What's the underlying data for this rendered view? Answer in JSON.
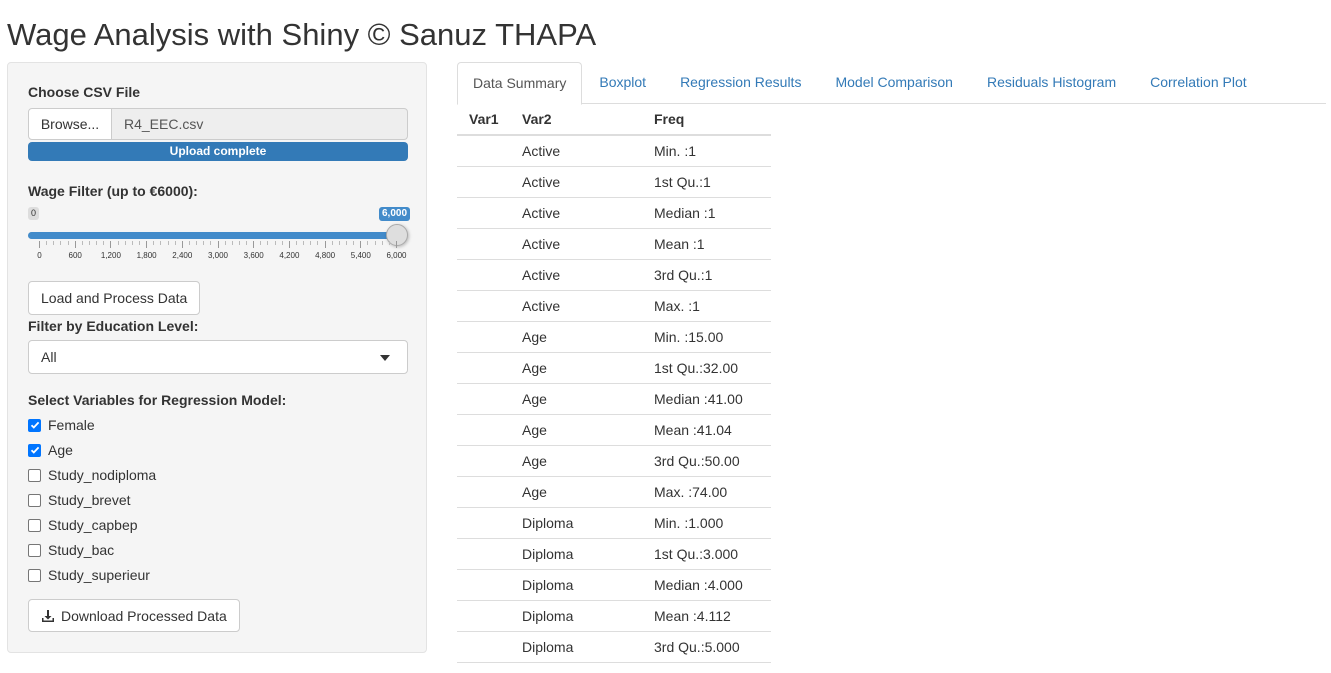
{
  "app": {
    "title": "Wage Analysis with Shiny © Sanuz THAPA"
  },
  "sidebar": {
    "file_label": "Choose CSV File",
    "browse_label": "Browse...",
    "file_name": "R4_EEC.csv",
    "upload_status": "Upload complete",
    "upload_progress": 1.0,
    "wage_label": "Wage Filter (up to €6000):",
    "slider": {
      "min_label": "0",
      "max_label": "6,000",
      "value": 6000,
      "min": 0,
      "max": 6000,
      "ticks": [
        "0",
        "600",
        "1,200",
        "1,800",
        "2,400",
        "3,000",
        "3,600",
        "4,200",
        "4,800",
        "5,400",
        "6,000"
      ]
    },
    "load_button": "Load and Process Data",
    "education_label": "Filter by Education Level:",
    "education_selected": "All",
    "variables_label": "Select Variables for Regression Model:",
    "variables": [
      {
        "label": "Female",
        "checked": true
      },
      {
        "label": "Age",
        "checked": true
      },
      {
        "label": "Study_nodiploma",
        "checked": false
      },
      {
        "label": "Study_brevet",
        "checked": false
      },
      {
        "label": "Study_capbep",
        "checked": false
      },
      {
        "label": "Study_bac",
        "checked": false
      },
      {
        "label": "Study_superieur",
        "checked": false
      }
    ],
    "download_button": "Download Processed Data"
  },
  "tabs": [
    {
      "label": "Data Summary",
      "active": true
    },
    {
      "label": "Boxplot",
      "active": false
    },
    {
      "label": "Regression Results",
      "active": false
    },
    {
      "label": "Model Comparison",
      "active": false
    },
    {
      "label": "Residuals Histogram",
      "active": false
    },
    {
      "label": "Correlation Plot",
      "active": false
    }
  ],
  "summary_table": {
    "columns": [
      "Var1",
      "Var2",
      "Freq"
    ],
    "rows": [
      [
        "",
        "Active",
        "Min. :1"
      ],
      [
        "",
        "Active",
        "1st Qu.:1"
      ],
      [
        "",
        "Active",
        "Median :1"
      ],
      [
        "",
        "Active",
        "Mean :1"
      ],
      [
        "",
        "Active",
        "3rd Qu.:1"
      ],
      [
        "",
        "Active",
        "Max. :1"
      ],
      [
        "",
        "Age",
        "Min. :15.00"
      ],
      [
        "",
        "Age",
        "1st Qu.:32.00"
      ],
      [
        "",
        "Age",
        "Median :41.00"
      ],
      [
        "",
        "Age",
        "Mean :41.04"
      ],
      [
        "",
        "Age",
        "3rd Qu.:50.00"
      ],
      [
        "",
        "Age",
        "Max. :74.00"
      ],
      [
        "",
        "Diploma",
        "Min. :1.000"
      ],
      [
        "",
        "Diploma",
        "1st Qu.:3.000"
      ],
      [
        "",
        "Diploma",
        "Median :4.000"
      ],
      [
        "",
        "Diploma",
        "Mean :4.112"
      ],
      [
        "",
        "Diploma",
        "3rd Qu.:5.000"
      ]
    ]
  },
  "icons": {
    "download": "download-icon",
    "caret": "chevron-down-icon",
    "check": "check-icon"
  },
  "colors": {
    "accent": "#337ab7",
    "slider": "#428bca",
    "checkbox": "#0075ff"
  }
}
